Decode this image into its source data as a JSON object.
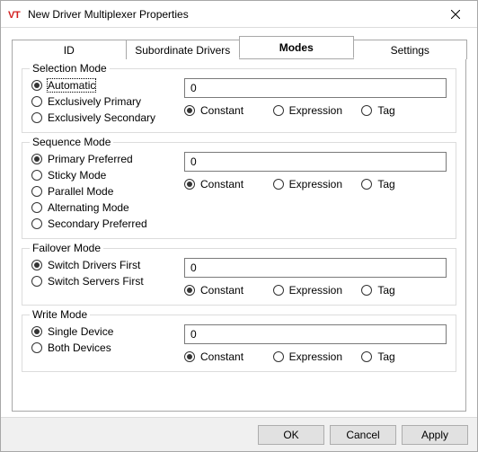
{
  "window": {
    "title": "New Driver Multiplexer Properties"
  },
  "tabs": {
    "id": "ID",
    "subordinate": "Subordinate Drivers",
    "modes": "Modes",
    "settings": "Settings"
  },
  "valtypes": {
    "constant": "Constant",
    "expression": "Expression",
    "tag": "Tag"
  },
  "groups": {
    "selection": {
      "title": "Selection Mode",
      "value": "0",
      "options": {
        "automatic": "Automatic",
        "excl_primary": "Exclusively Primary",
        "excl_secondary": "Exclusively Secondary"
      }
    },
    "sequence": {
      "title": "Sequence Mode",
      "value": "0",
      "options": {
        "primary_pref": "Primary Preferred",
        "sticky": "Sticky Mode",
        "parallel": "Parallel Mode",
        "alternating": "Alternating Mode",
        "secondary_pref": "Secondary Preferred"
      }
    },
    "failover": {
      "title": "Failover Mode",
      "value": "0",
      "options": {
        "drivers_first": "Switch Drivers First",
        "servers_first": "Switch Servers First"
      }
    },
    "write": {
      "title": "Write Mode",
      "value": "0",
      "options": {
        "single": "Single Device",
        "both": "Both Devices"
      }
    }
  },
  "buttons": {
    "ok": "OK",
    "cancel": "Cancel",
    "apply": "Apply"
  }
}
